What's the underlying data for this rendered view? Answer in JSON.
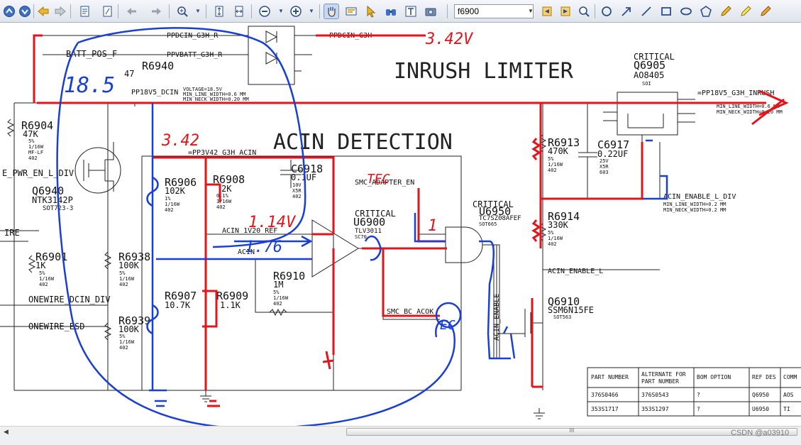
{
  "toolbar": {
    "find_value": "f6900",
    "icons": [
      "up-icon",
      "down-icon",
      "back-icon",
      "forward-icon",
      "page-icon",
      "page-icon",
      "undo-icon",
      "redo-icon",
      "zoom-in-icon",
      "fit-page-icon",
      "fit-width-icon",
      "zoom-out-minus-icon",
      "zoom-in-plus-icon",
      "hand-icon",
      "select-text-icon",
      "pointer-icon",
      "binoculars-icon",
      "text-select-icon",
      "snapshot-icon",
      "find-prev-icon",
      "find-next-icon",
      "search-icon",
      "circle-icon",
      "arrow-icon",
      "line-icon",
      "rectangle-icon",
      "oval-icon",
      "polygon-icon",
      "pencil-icon",
      "highlighter-icon",
      "pen-icon"
    ]
  },
  "schematic": {
    "headings": {
      "inrush": "INRUSH LIMITER",
      "acin": "ACIN DETECTION"
    },
    "critical_labels": [
      "CRITICAL",
      "CRITICAL",
      "CRITICAL"
    ],
    "refdes": {
      "r6940": "R6940",
      "r6904": "R6904",
      "q6940": "Q6940",
      "r6901": "R6901",
      "r6938": "R6938",
      "r6939": "R6939",
      "r6906": "R6906",
      "r6908": "R6908",
      "r6907": "R6907",
      "r6909": "R6909",
      "c6918": "C6918",
      "u6900": "U6900",
      "r6910": "R6910",
      "u6950": "U6950",
      "r6913": "R6913",
      "c6917": "C6917",
      "r6914": "R6914",
      "q6910": "Q6910",
      "q6905": "Q6905"
    },
    "values": {
      "r6940": "47",
      "r6904": "47K",
      "q6940": "NTK3142P",
      "r6901": "1K",
      "r6938": "100K",
      "r6939": "100K",
      "r6906": "102K",
      "r6908": "2K",
      "r6907": "10.7K",
      "r6909": "1.1K",
      "c6918": "0.1UF",
      "r6910": "1M",
      "u6950": "TC7SZ08AFEF",
      "r6913": "470K",
      "c6917": "0.22UF",
      "r6914": "330K",
      "q6910": "SSM6N15FE",
      "q6905": "AO8405"
    },
    "nets": {
      "ppdcin": "PPDCIN_G3H_R",
      "ppdcin_out": "=PPDCIN_G3H",
      "batt_pos": "BATT_POS_F",
      "ppvbatt": "PPVBATT_G3H_R",
      "pp18v5": "PP18V5_DCIN",
      "pp18v5_out": "=PP18V5_G3H_INRUSH",
      "voltage": "VOLTAGE=18.5V",
      "line_width": "MIN_LINE_WIDTH=0.6 MM",
      "neck_width": "MIN_NECK_WIDTH=0.20 MM",
      "ppp3v42": "=PP3V42_G3H_ACIN",
      "smc_adapter_en": "SMC_ADAPTER_EN",
      "acin_1v20": "ACIN_1V20_REF",
      "acin_enable_l_div": "ACIN_ENABLE_L_DIV",
      "line_width2": "MIN_LINE_WIDTH=0.2 MM",
      "neck_width2": "MIN_NECK_WIDTH=0.2 MM",
      "acin_enable_l": "ACIN_ENABLE_L",
      "smc_bc_acok": "SMC_BC_ACOK",
      "onewire_dcin": "ONEWIRE_DCIN_DIV",
      "onewire_esd": "ONEWIRE_ESD",
      "pwr_en": "E_PWR_EN_L_DIV",
      "ire": "IRE",
      "acin": "ACIN",
      "acin_enable_v": "ACIN_ENABLE"
    },
    "parts": {
      "q6940_pkg": "SOT723-3",
      "u6950_pkg": "SOT665",
      "q6910_pkg": "SOT563",
      "u6900_pkg": "SC70",
      "u6900_val": "TLV3011",
      "c6917_pkg": "603",
      "q6905_pkg": "SOI"
    },
    "small_text": [
      "5%",
      "1/16W",
      "MF-LF",
      "402",
      "10V",
      "X5R",
      "25V",
      "1%",
      "0.1%"
    ],
    "table": {
      "headers": [
        "PART NUMBER",
        "ALTERNATE FOR\nPART NUMBER",
        "BOM OPTION",
        "REF DES",
        "COMM"
      ],
      "rows": [
        [
          "376S0466",
          "376S0543",
          "?",
          "Q6950",
          "AOS"
        ],
        [
          "353S1717",
          "353S1297",
          "?",
          "U6950",
          "TI"
        ]
      ]
    }
  },
  "annotations": {
    "v_342_top": "3.42V",
    "v_185": "18.5",
    "v_342": "3.42",
    "v_114": "1.14V",
    "v_176": "1.76",
    "tec": "TEC",
    "one": "1",
    "ec": "EC",
    "colors": {
      "red": "#e4141b",
      "blue": "#1a3fd6"
    }
  },
  "scrollbar": {
    "grip": "III"
  },
  "watermark": "CSDN @a03910"
}
